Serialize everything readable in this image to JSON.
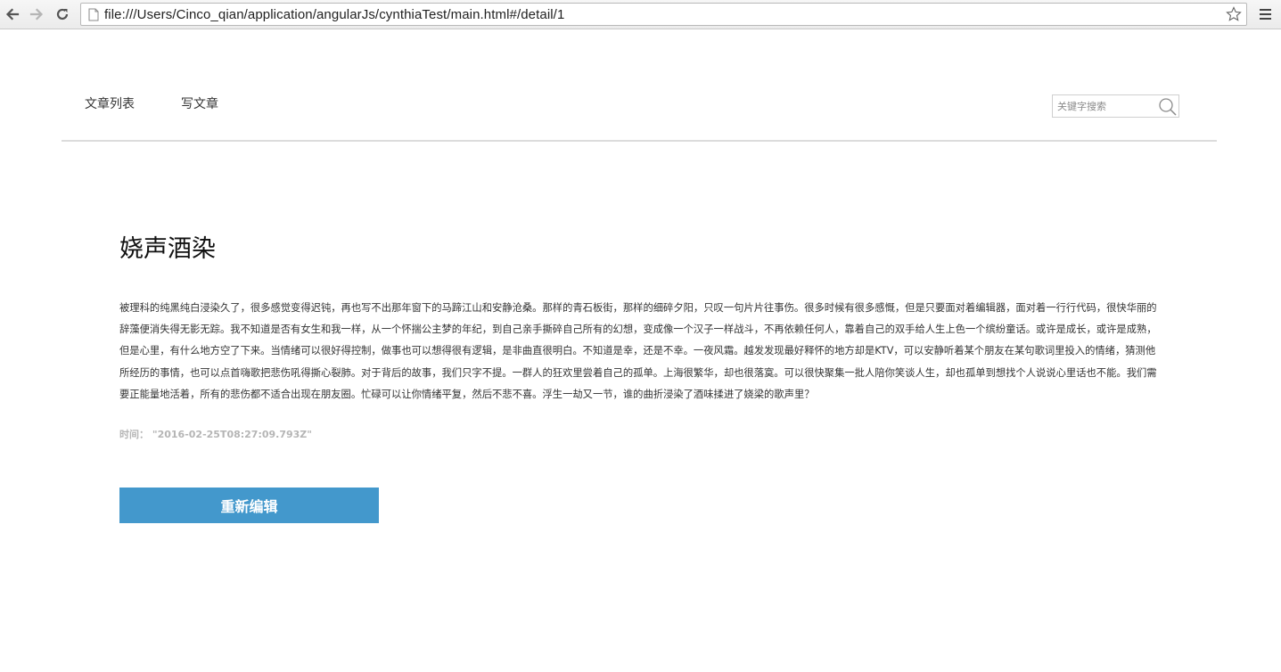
{
  "browser": {
    "url": "file:///Users/Cinco_qian/application/angularJs/cynthiaTest/main.html#/detail/1",
    "icons": {
      "back": "arrow-left-icon",
      "forward": "arrow-right-icon",
      "reload": "reload-icon",
      "page": "document-icon",
      "bookmark": "star-icon",
      "menu": "hamburger-menu-icon"
    }
  },
  "nav": {
    "items": [
      {
        "label": "文章列表"
      },
      {
        "label": "写文章"
      }
    ],
    "search": {
      "placeholder": "关键字搜索",
      "value": "",
      "icon": "search-icon"
    }
  },
  "article": {
    "title": "娆声酒染",
    "body": "被理科的纯黑纯白浸染久了，很多感觉变得迟钝，再也写不出那年窗下的马蹄江山和安静沧桑。那样的青石板街，那样的细碎夕阳，只叹一句片片往事伤。很多时候有很多感慨，但是只要面对着编辑器，面对着一行行代码，很快华丽的辞藻便消失得无影无踪。我不知道是否有女生和我一样，从一个怀揣公主梦的年纪，到自己亲手撕碎自己所有的幻想，变成像一个汉子一样战斗，不再依赖任何人，靠着自己的双手给人生上色一个缤纷童话。或许是成长，或许是成熟，但是心里，有什么地方空了下来。当情绪可以很好得控制，做事也可以想得很有逻辑，是非曲直很明白。不知道是幸，还是不幸。一夜风霜。越发发现最好释怀的地方却是KTV，可以安静听着某个朋友在某句歌词里投入的情绪，猜测他所经历的事情，也可以点首嗨歌把悲伤吼得撕心裂肺。对于背后的故事，我们只字不提。一群人的狂欢里尝着自己的孤单。上海很繁华，却也很落寞。可以很快聚集一批人陪你笑谈人生，却也孤单到想找个人说说心里话也不能。我们需要正能量地活着，所有的悲伤都不适合出现在朋友圈。忙碌可以让你情绪平复，然后不悲不喜。浮生一劫又一节，谁的曲折浸染了酒味揉进了娆梁的歌声里？",
    "time_label": "时间：",
    "time_value": "\"2016-02-25T08:27:09.793Z\"",
    "edit_label": "重新编辑"
  },
  "colors": {
    "accent": "#4398cc",
    "divider": "#dcdcdc",
    "muted": "#b5b5b5"
  }
}
